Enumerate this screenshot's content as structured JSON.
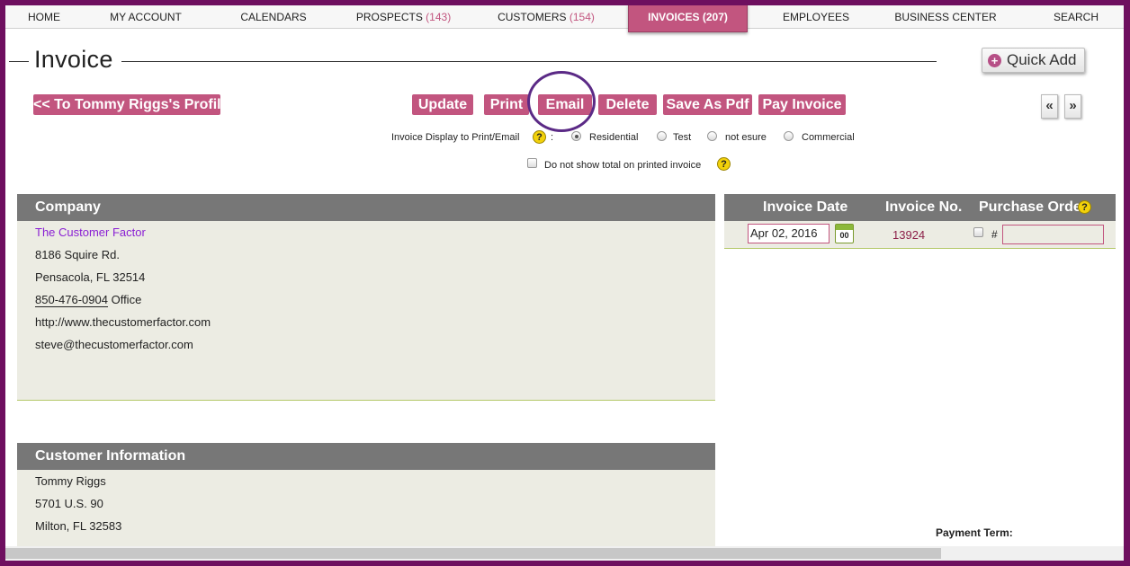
{
  "nav": {
    "items": [
      {
        "label": "HOME",
        "count": ""
      },
      {
        "label": "MY ACCOUNT",
        "count": ""
      },
      {
        "label": "CALENDARS",
        "count": ""
      },
      {
        "label": "PROSPECTS",
        "count": "(143)"
      },
      {
        "label": "CUSTOMERS",
        "count": "(154)"
      },
      {
        "label": "INVOICES",
        "count": "(207)"
      },
      {
        "label": "EMPLOYEES",
        "count": ""
      },
      {
        "label": "BUSINESS CENTER",
        "count": ""
      },
      {
        "label": "SEARCH",
        "count": ""
      }
    ],
    "active": "INVOICES"
  },
  "page": {
    "title": "Invoice",
    "quick_add": "Quick Add"
  },
  "actions": {
    "back_profile": "<< To Tommy Riggs's Profile",
    "update": "Update",
    "print": "Print",
    "email": "Email",
    "delete": "Delete",
    "save_pdf": "Save As Pdf",
    "pay_invoice": "Pay Invoice",
    "prev": "«",
    "next": "»"
  },
  "display_options": {
    "label": "Invoice Display to Print/Email",
    "colon": ":",
    "help": "?",
    "radios": [
      "Residential",
      "Test",
      "not esure",
      "Commercial"
    ],
    "selected": "Residential",
    "hide_total_label": "Do not show total on printed invoice",
    "hide_total_checked": false
  },
  "company": {
    "header": "Company",
    "name": "The Customer Factor",
    "street": "8186 Squire Rd.",
    "city_state_zip": "Pensacola, FL  32514",
    "phone": "850-476-0904",
    "phone_type": " Office",
    "website": "http://www.thecustomerfactor.com",
    "email": "steve@thecustomerfactor.com"
  },
  "customer": {
    "header": "Customer Information",
    "name": "Tommy Riggs",
    "street": "5701 U.S. 90",
    "city_state_zip": "Milton, FL 32583"
  },
  "invoice_meta": {
    "date_header": "Invoice Date",
    "number_header": "Invoice No.",
    "po_header": "Purchase Order",
    "date_value": "Apr 02, 2016",
    "calendar_day": "00",
    "number_value": "13924",
    "po_hash": "#",
    "po_value": ""
  },
  "payment_term_label": "Payment Term:",
  "colors": {
    "brand": "#c2557f",
    "frame": "#6e0f5f",
    "panel_header": "#777777",
    "panel_bg": "#ecece3"
  }
}
